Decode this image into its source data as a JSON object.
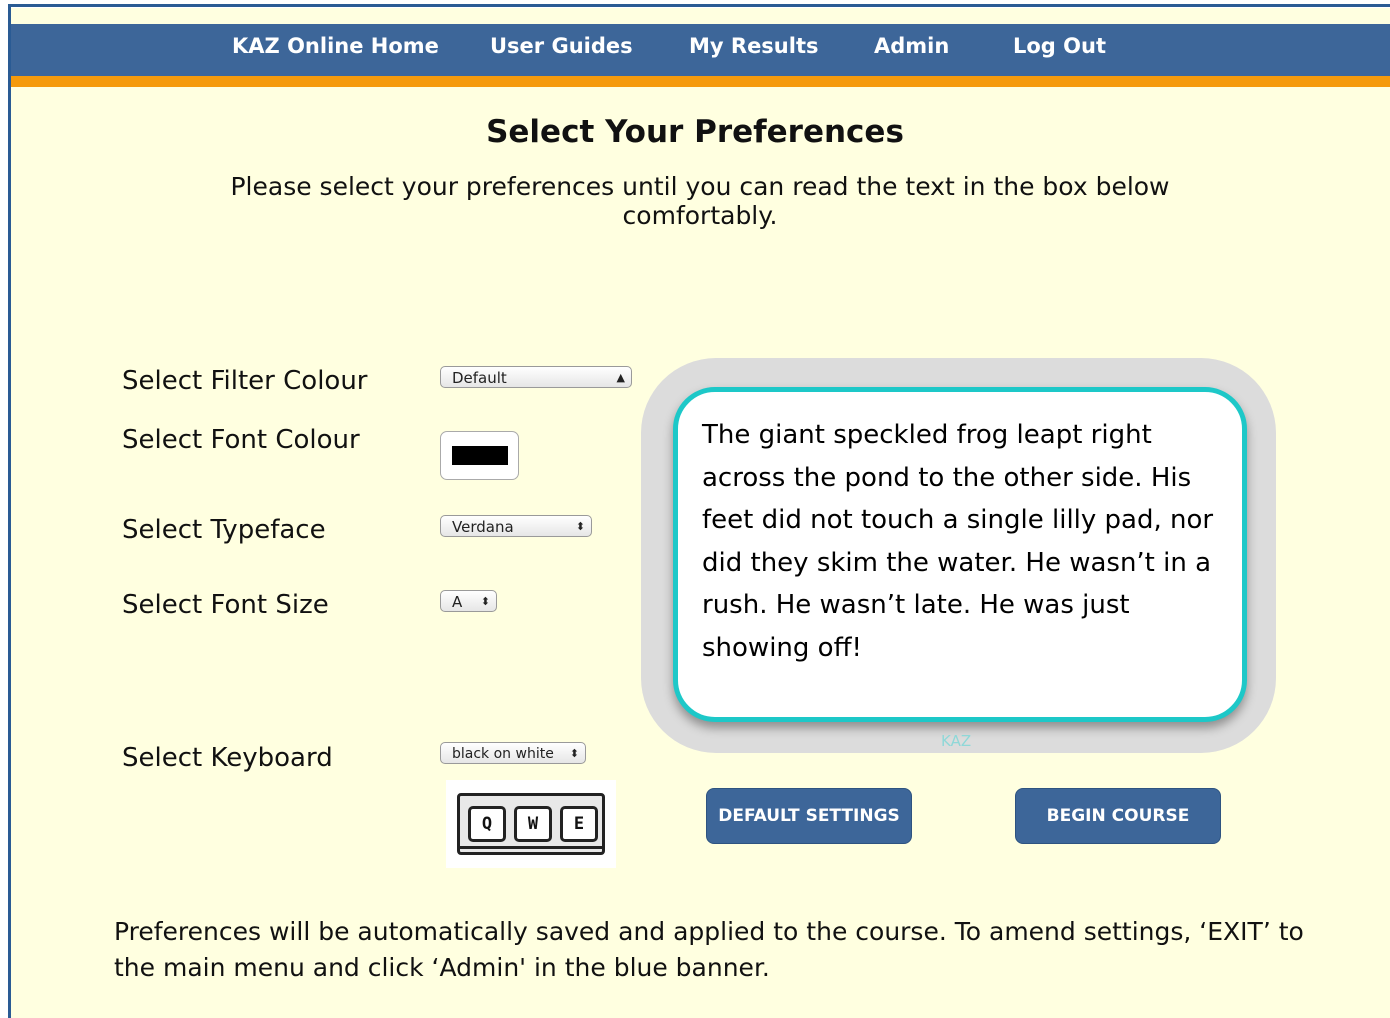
{
  "nav": {
    "items": [
      {
        "label": "KAZ Online Home"
      },
      {
        "label": "User Guides"
      },
      {
        "label": "My Results"
      },
      {
        "label": "Admin"
      },
      {
        "label": "Log Out"
      }
    ]
  },
  "page": {
    "title": "Select Your Preferences",
    "intro": "Please select your preferences until you can read the text in the box below comfortably."
  },
  "form": {
    "filter_colour": {
      "label": "Select Filter Colour",
      "value": "Default"
    },
    "font_colour": {
      "label": "Select Font Colour",
      "value": "#000000"
    },
    "typeface": {
      "label": "Select Typeface",
      "value": "Verdana"
    },
    "font_size": {
      "label": "Select Font Size",
      "value": "A"
    },
    "keyboard": {
      "label": "Select Keyboard",
      "value": "black on white",
      "preview_keys": [
        "Q",
        "W",
        "E"
      ]
    }
  },
  "preview": {
    "text": "The giant speckled frog leapt right across the pond to the other side. His feet did not touch a single lilly pad, nor did they skim the water. He wasn’t in a rush. He wasn’t late. He was just showing off!",
    "mark": "KAZ"
  },
  "buttons": {
    "default_settings": "DEFAULT SETTINGS",
    "begin_course": "BEGIN COURSE"
  },
  "footer": {
    "text": "Preferences will be automatically saved and applied to the course. To amend settings, ‘EXIT’ to the main menu and click ‘Admin' in the blue banner."
  },
  "colors": {
    "nav_bg": "#3d6699",
    "nav_underline": "#f59a0c",
    "page_bg": "#ffffe0",
    "preview_border": "#1dc8c8"
  }
}
